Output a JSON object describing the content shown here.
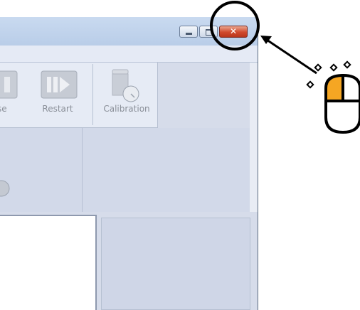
{
  "window": {
    "title_buttons": {
      "minimize_icon": "minimize-icon",
      "maximize_icon": "maximize-icon",
      "close_glyph": "✕",
      "close_color": "#d04a2d"
    }
  },
  "toolbar": {
    "items": [
      {
        "label": "se",
        "icon": "pause-icon"
      },
      {
        "label": "Restart",
        "icon": "restart-icon"
      },
      {
        "label": "Calibration",
        "icon": "calibration-icon"
      }
    ]
  },
  "annotation": {
    "highlight_color": "#000000",
    "mouse_button_color": "#f5a623",
    "icon": "mouse-left-click-icon"
  }
}
